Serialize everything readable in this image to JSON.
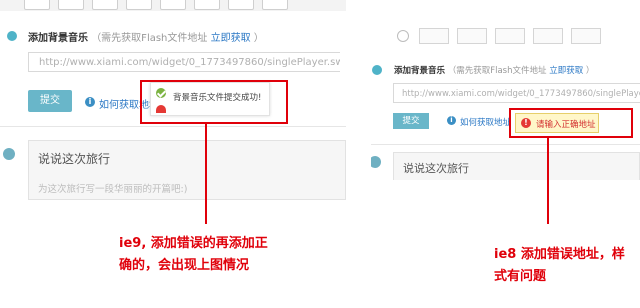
{
  "left_panel": {
    "section_label": "添加背景音乐",
    "section_hint": "（需先获取Flash文件地址",
    "section_link": "立即获取",
    "section_hint_close": "）",
    "url_value": "http://www.xiami.com/widget/0_1773497860/singlePlayer.swf",
    "submit_label": "提交",
    "help_link": "如何获取地址",
    "tooltip_success": "背景音乐文件提交成功!",
    "travel_title": "说说这次旅行",
    "travel_placeholder": "为这次旅行写一段华丽丽的开篇吧:)"
  },
  "right_panel": {
    "section_label": "添加背景音乐",
    "section_hint": "（需先获取Flash文件地址",
    "section_link": "立即获取",
    "section_hint_close": "）",
    "url_value": "http://www.xiami.com/widget/0_1773497860/singlePlayer.s",
    "submit_label": "提交",
    "help_link": "如何获取地址",
    "error_text": "请输入正确地址",
    "travel_title": "说说这次旅行"
  },
  "annotations": {
    "ie9_line1": "ie9, 添加错误的再添加正",
    "ie9_line2": "确的，会出现上图情况",
    "ie8_line1": "ie8 添加错误地址，样",
    "ie8_line2": "式有问题"
  },
  "colors": {
    "accent_red": "#e0000a",
    "submit_blue": "#69b6c9",
    "link_blue": "#2b78c5"
  }
}
